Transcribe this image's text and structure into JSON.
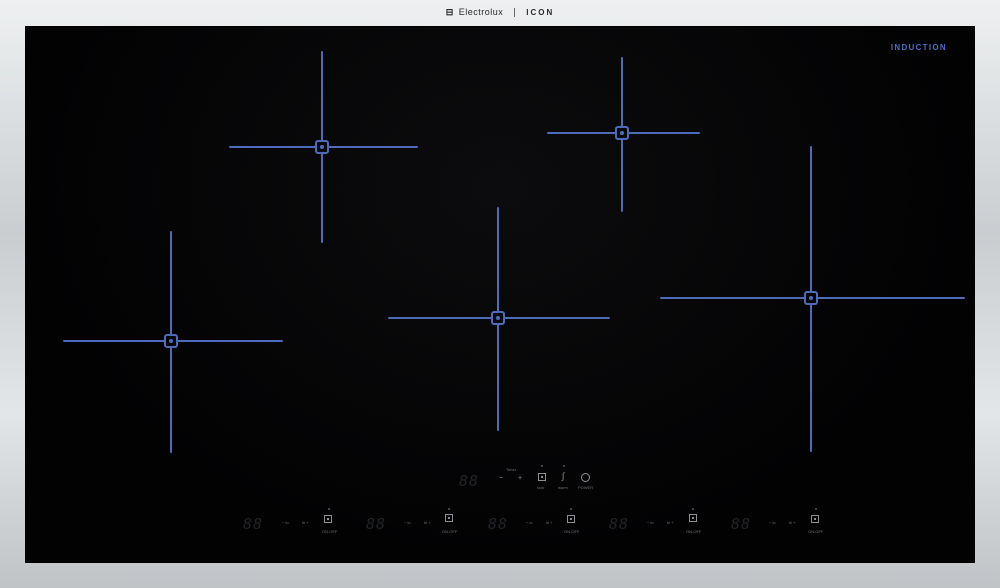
{
  "brand": {
    "name": "Electrolux",
    "line": "ICON"
  },
  "badge": "INDUCTION",
  "colors": {
    "zone_line": "#4d6bb8",
    "glass": "#040405",
    "frame": "#d7dadc",
    "badge": "#4b6fc4"
  },
  "center_panel": {
    "display": "88",
    "timer_label": "Timer",
    "lock_label": "lock",
    "warm_label": "warm",
    "power_label": "POWER"
  },
  "zone_controls": [
    {
      "display": "88",
      "lo": "lo",
      "hi": "hi",
      "button_label": "ON-OFF"
    },
    {
      "display": "88",
      "lo": "lo",
      "hi": "hi",
      "button_label": "ON-OFF"
    },
    {
      "display": "88",
      "lo": "lo",
      "hi": "hi",
      "button_label": "ON-OFF"
    },
    {
      "display": "88",
      "lo": "lo",
      "hi": "hi",
      "button_label": "ON-OFF"
    },
    {
      "display": "88",
      "lo": "lo",
      "hi": "hi",
      "button_label": "ON-OFF"
    }
  ]
}
